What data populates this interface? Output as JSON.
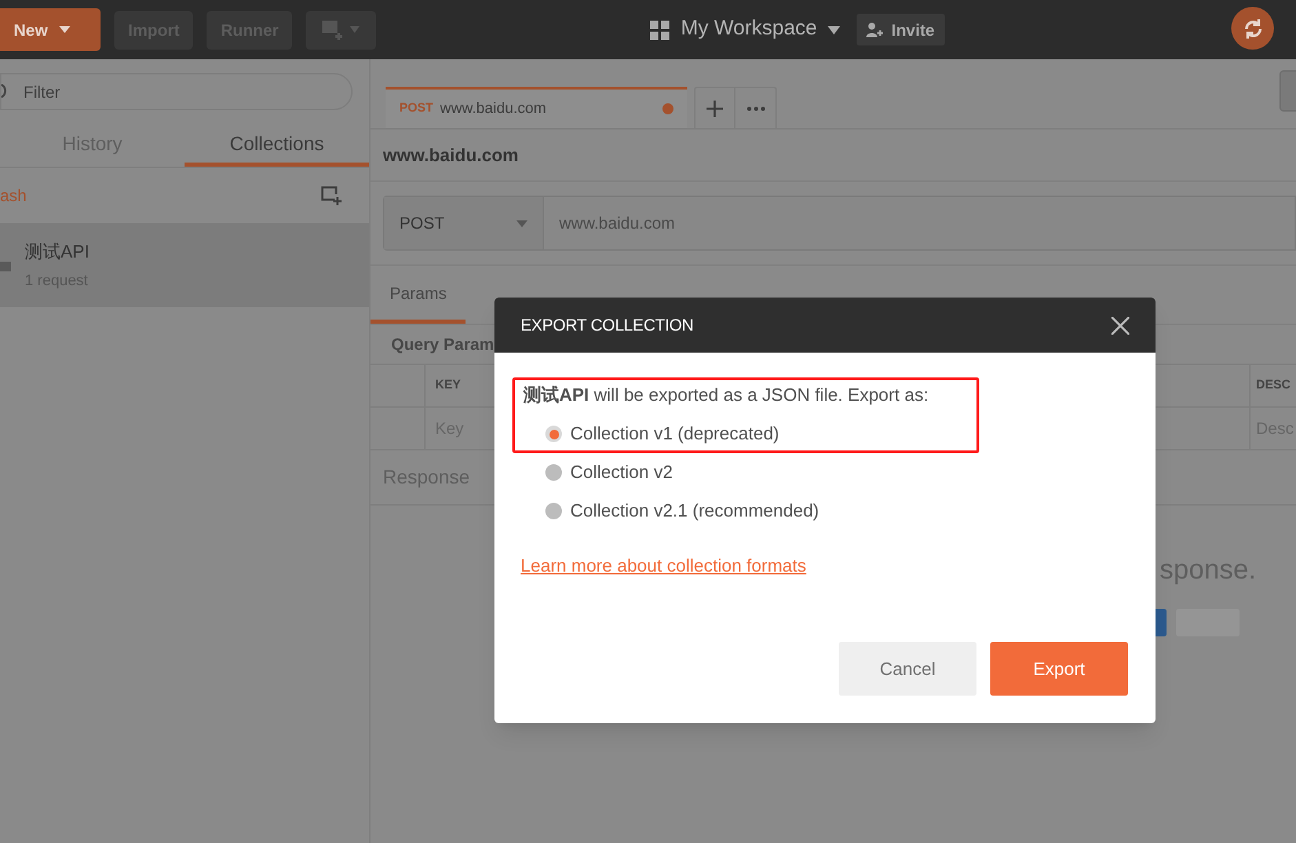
{
  "toolbar": {
    "new_button": "New",
    "buttons": [
      "Import",
      "Runner"
    ],
    "workspace": "My Workspace",
    "invite": "Invite"
  },
  "sidebar": {
    "filter_placeholder": "Filter",
    "tabs": [
      {
        "label": "History",
        "selected": false
      },
      {
        "label": "Collections",
        "selected": true
      }
    ],
    "trash_link": "ash",
    "collections": [
      {
        "name": "测试API",
        "count": "1 request",
        "selected": true
      }
    ]
  },
  "request_tabs": [
    {
      "method": "POST",
      "url": "www.baidu.com",
      "selected": true,
      "unsaved": true
    }
  ],
  "request": {
    "title": "www.baidu.com",
    "method": "POST",
    "url": "www.baidu.com",
    "tabs": [
      {
        "label": "Params",
        "selected": true
      }
    ],
    "query_params_title": "Query Param",
    "columns": [
      "KEY",
      "DESC"
    ],
    "placeholders": [
      "Key",
      "Desc"
    ],
    "response_title": "Response",
    "response_hint": "sponse."
  },
  "modal": {
    "title": "EXPORT COLLECTION",
    "message": "**测试API** will be exported as a JSON file. Export as:",
    "options": [
      {
        "label": "Collection v1 (deprecated)",
        "selected": true,
        "highlighted": true
      },
      {
        "label": "Collection v2",
        "selected": false,
        "highlighted": false
      },
      {
        "label": "Collection v2.1 (recommended)",
        "selected": false,
        "highlighted": false
      }
    ],
    "link": "Learn more about collection formats",
    "cancel": "Cancel",
    "confirm": "Export"
  }
}
